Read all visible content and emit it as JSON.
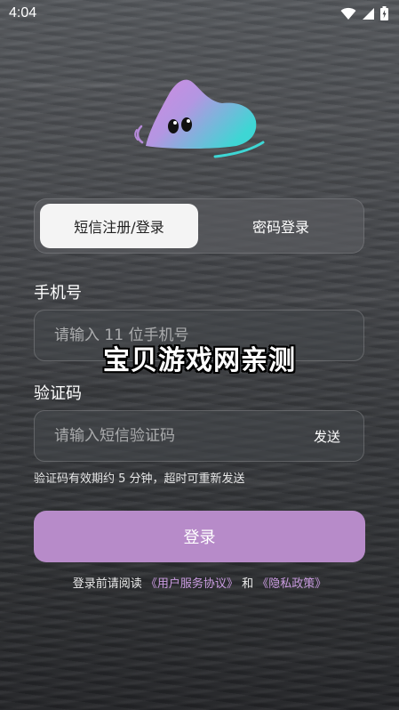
{
  "status_bar": {
    "time": "4:04",
    "icons": [
      "wifi-icon",
      "signal-icon",
      "battery-icon"
    ]
  },
  "logo": {
    "gradient_start": "#d28ae0",
    "gradient_end": "#3ed6d4"
  },
  "tabs": [
    {
      "label": "短信注册/登录",
      "active": true
    },
    {
      "label": "密码登录",
      "active": false
    }
  ],
  "phone": {
    "label": "手机号",
    "placeholder": "请输入 11 位手机号",
    "value": ""
  },
  "code": {
    "label": "验证码",
    "placeholder": "请输入短信验证码",
    "value": "",
    "send_label": "发送"
  },
  "watermark": "宝贝游戏网亲测",
  "hint": "验证码有效期约 5 分钟，超时可重新发送",
  "login_button": "登录",
  "agreement": {
    "prefix": "登录前请阅读 ",
    "terms_link": "《用户服务协议》",
    "connector": " 和 ",
    "privacy_link": "《隐私政策》"
  },
  "colors": {
    "accent": "#b78bc9",
    "link": "#c99be0"
  }
}
